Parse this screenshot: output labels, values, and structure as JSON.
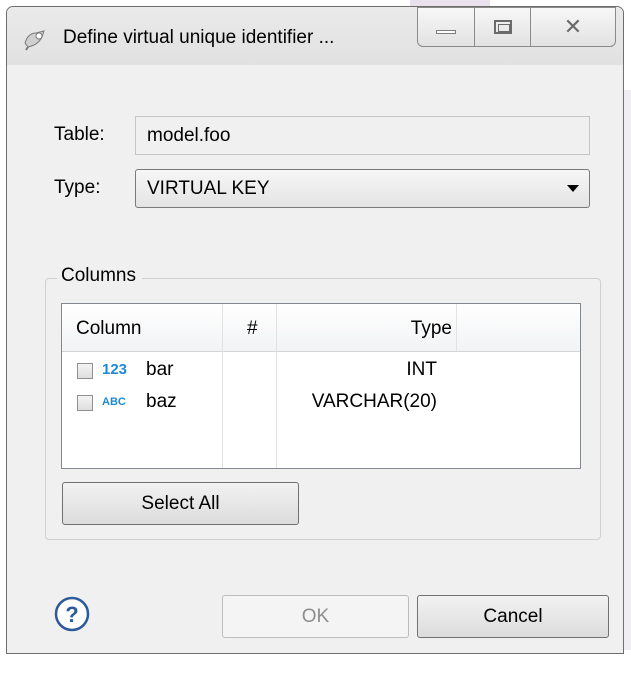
{
  "window": {
    "title": "Define virtual unique identifier ...",
    "controls": [
      "minimize-icon",
      "maximize-icon",
      "close-icon"
    ]
  },
  "form": {
    "table_label": "Table:",
    "table_value": "model.foo",
    "type_label": "Type:",
    "type_value": "VIRTUAL KEY"
  },
  "columns_group": {
    "legend": "Columns",
    "headers": [
      "Column",
      "#",
      "Type"
    ],
    "rows": [
      {
        "icon_text": "123",
        "icon": "integer-type-icon",
        "name": "bar",
        "number": "",
        "type": "INT",
        "checked": false
      },
      {
        "icon_text": "ABC",
        "icon": "string-type-icon",
        "name": "baz",
        "number": "",
        "type": "VARCHAR(20)",
        "checked": false
      }
    ],
    "select_all_label": "Select All"
  },
  "footer": {
    "help_icon": "help-icon",
    "ok_label": "OK",
    "ok_enabled": false,
    "cancel_label": "Cancel"
  },
  "colors": {
    "window_bg": "#f0f0f0",
    "type_icon_blue": "#1e8ad6",
    "help_blue": "#2d5a9b"
  }
}
